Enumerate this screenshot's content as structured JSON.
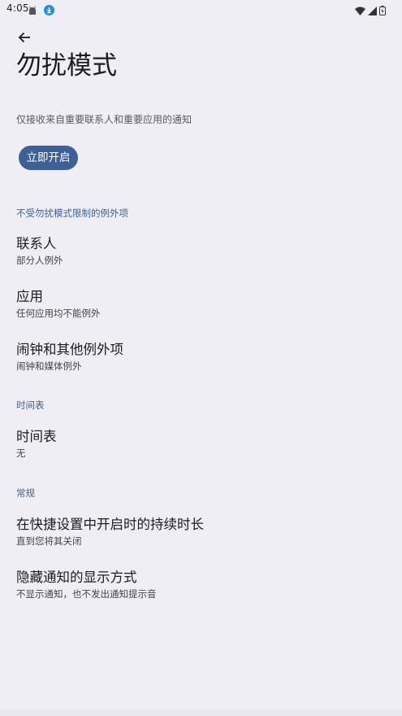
{
  "status_bar": {
    "time": "4:05",
    "left_icons": [
      "android-icon",
      "download-icon"
    ],
    "right_icons": [
      "wifi-icon",
      "signal-icon",
      "battery-icon"
    ]
  },
  "header": {
    "title": "勿扰模式"
  },
  "main": {
    "description": "仅接收来自重要联系人和重要应用的通知",
    "enable_button_label": "立即开启",
    "accent_color": "#3f5f98",
    "sections": [
      {
        "header": "不受勿扰模式限制的例外项",
        "items": [
          {
            "title": "联系人",
            "summary": "部分人例外"
          },
          {
            "title": "应用",
            "summary": "任何应用均不能例外"
          },
          {
            "title": "闹钟和其他例外项",
            "summary": "闹钟和媒体例外"
          }
        ]
      },
      {
        "header": "时间表",
        "items": [
          {
            "title": "时间表",
            "summary": "无"
          }
        ]
      },
      {
        "header": "常规",
        "items": [
          {
            "title": "在快捷设置中开启时的持续时长",
            "summary": "直到您将其关闭"
          },
          {
            "title": "隐藏通知的显示方式",
            "summary": "不显示通知，也不发出通知提示音"
          }
        ]
      }
    ]
  }
}
